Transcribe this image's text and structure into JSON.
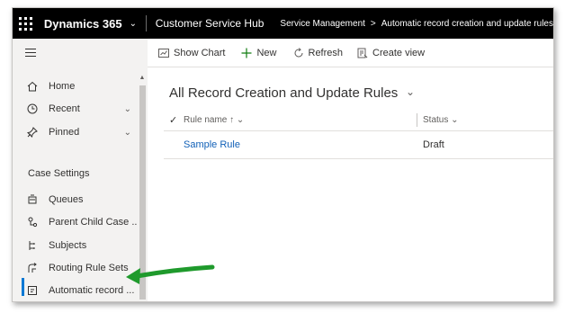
{
  "topbar": {
    "brand": "Dynamics 365",
    "app_name": "Customer Service Hub",
    "breadcrumb": [
      "Service Management",
      "Automatic record creation and update rules"
    ]
  },
  "sidebar": {
    "items": [
      {
        "label": "Home",
        "icon": "home-icon"
      },
      {
        "label": "Recent",
        "icon": "clock-icon"
      },
      {
        "label": "Pinned",
        "icon": "pin-icon"
      }
    ],
    "section_title": "Case Settings",
    "settings_items": [
      {
        "label": "Queues",
        "icon": "queue-icon"
      },
      {
        "label": "Parent Child Case ...",
        "icon": "parent-child-icon"
      },
      {
        "label": "Subjects",
        "icon": "subjects-icon"
      },
      {
        "label": "Routing Rule Sets",
        "icon": "routing-icon"
      },
      {
        "label": "Automatic record ...",
        "icon": "automatic-record-icon",
        "active": true
      }
    ]
  },
  "commandbar": {
    "show_chart": "Show Chart",
    "new": "New",
    "refresh": "Refresh",
    "create_view": "Create view"
  },
  "view": {
    "title": "All Record Creation and Update Rules",
    "columns": {
      "name": "Rule name",
      "status": "Status"
    },
    "rows": [
      {
        "name": "Sample Rule",
        "status": "Draft"
      }
    ]
  },
  "colors": {
    "topbar_bg": "#000000",
    "accent": "#0078d4",
    "link": "#1160b7",
    "arrow": "#1f9a2c"
  }
}
